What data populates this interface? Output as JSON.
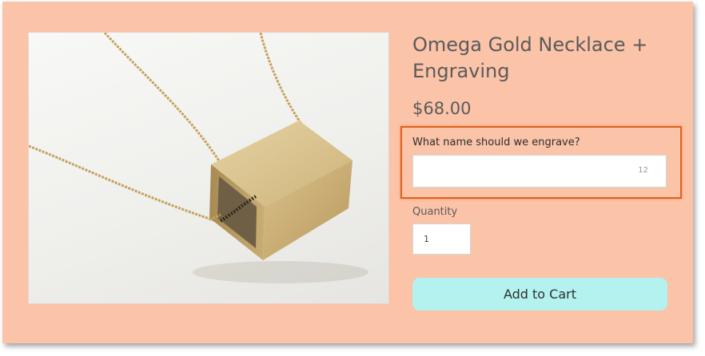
{
  "product": {
    "title": "Omega Gold Necklace + Engraving",
    "price": "$68.00",
    "image_alt": "gold-box-pendant-necklace"
  },
  "engraving": {
    "label": "What name should we engrave?",
    "value": "",
    "placeholder": "",
    "char_limit": "12"
  },
  "quantity": {
    "label": "Quantity",
    "value": "1"
  },
  "cart": {
    "button_label": "Add to Cart"
  },
  "colors": {
    "background": "#fbc3a8",
    "highlight_border": "#e0621f",
    "button": "#b3f2ef",
    "text": "#5b5b5b"
  }
}
